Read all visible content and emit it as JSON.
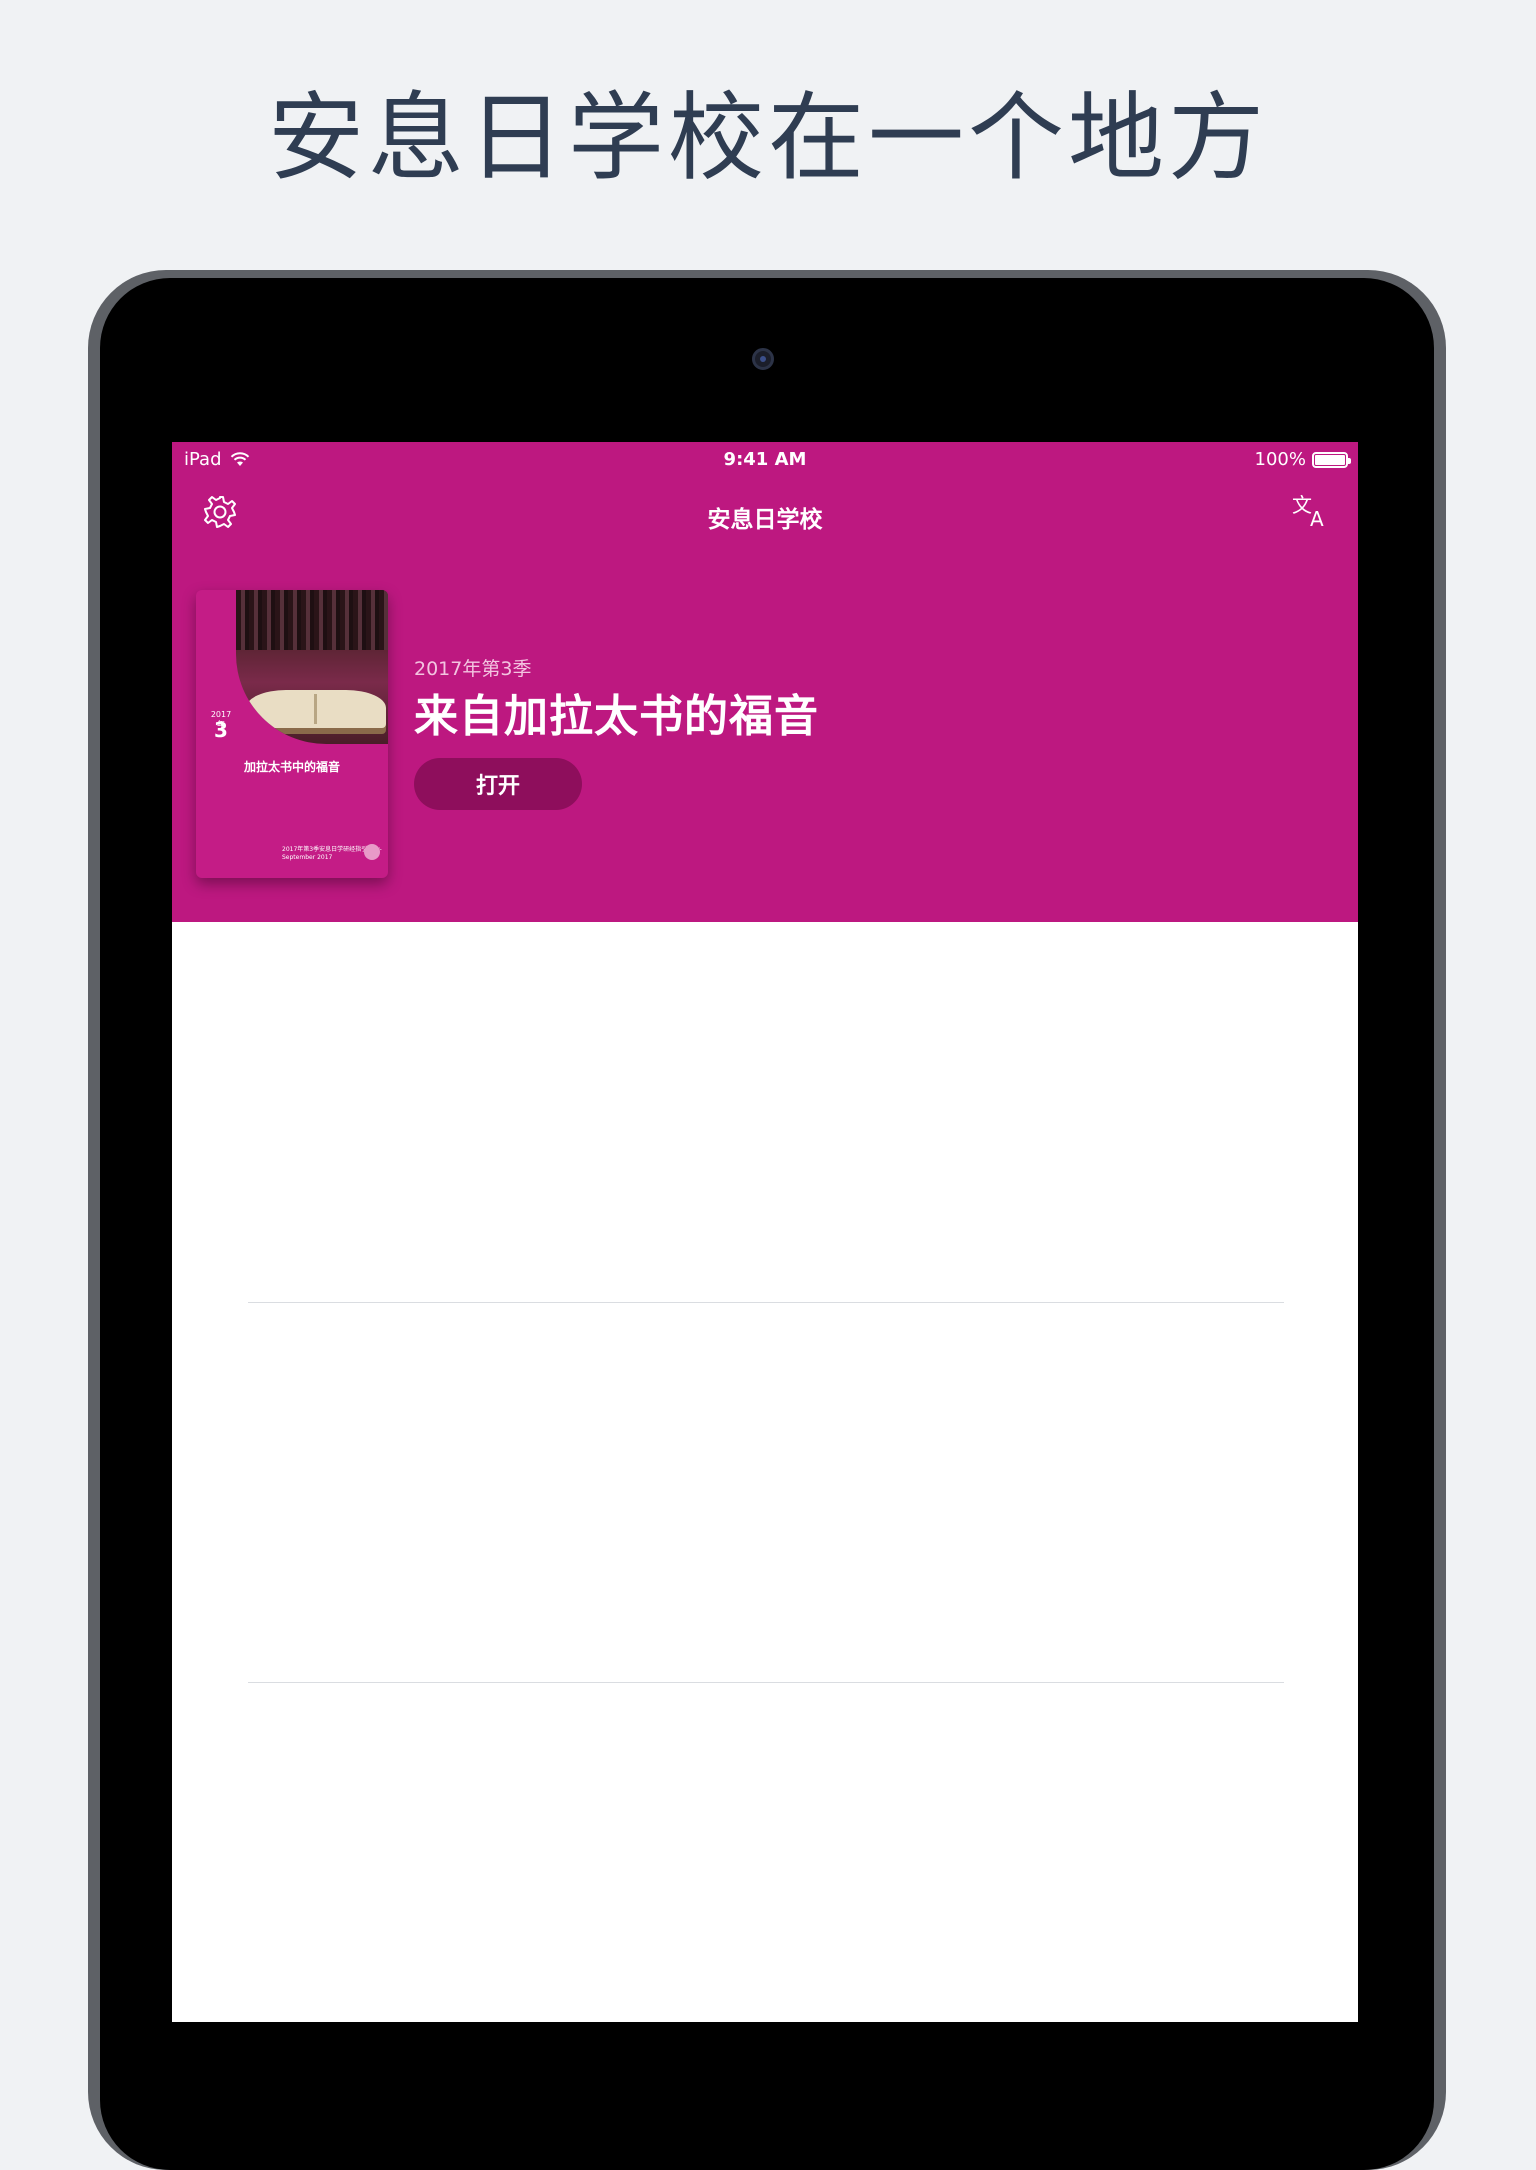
{
  "headline": "安息日学校在一个地方",
  "status_bar": {
    "device": "iPad",
    "time": "9:41 AM",
    "battery": "100%"
  },
  "nav": {
    "title": "安息日学校",
    "settings_icon": "gear-icon",
    "translate_icon": "translate-icon"
  },
  "featured": {
    "quarter_label": "2017年第3季",
    "title": "来自加拉太书的福音",
    "open_label": "打开",
    "cover": {
      "year": "2017年",
      "number": "3",
      "subtitle": "加拉太书中的福音",
      "footer": "2017年第3季安息日学研经指引 July-September 2017"
    }
  },
  "colors": {
    "header": "#bd1880",
    "button": "#8e0e5c"
  }
}
